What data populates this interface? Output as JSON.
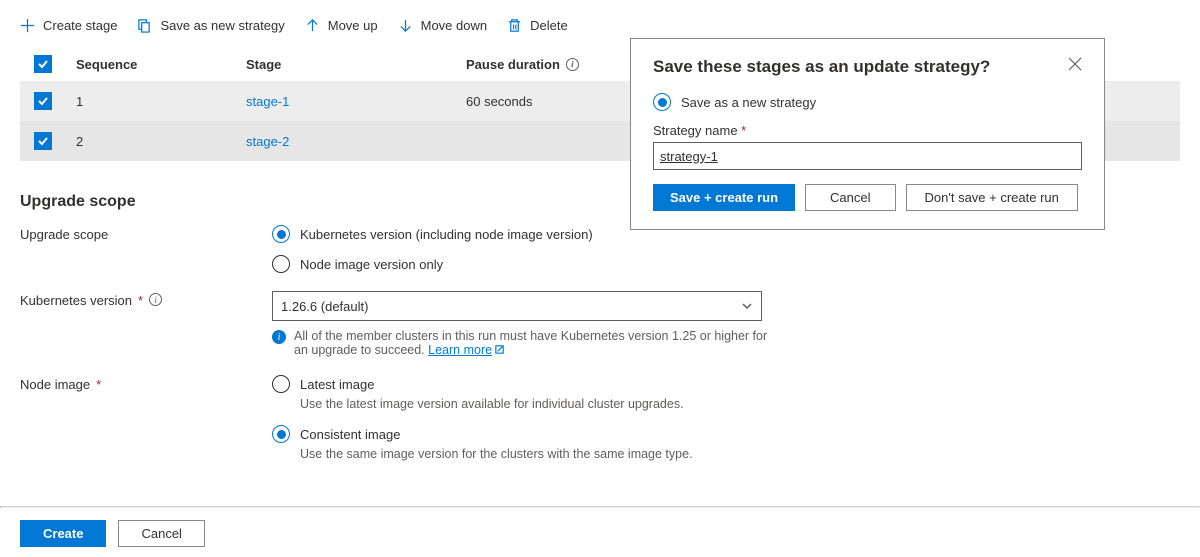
{
  "toolbar": {
    "create_stage": "Create stage",
    "save_strategy": "Save as new strategy",
    "move_up": "Move up",
    "move_down": "Move down",
    "delete": "Delete"
  },
  "table": {
    "headers": {
      "sequence": "Sequence",
      "stage": "Stage",
      "pause": "Pause duration"
    },
    "rows": [
      {
        "seq": "1",
        "stage": "stage-1",
        "pause": "60 seconds"
      },
      {
        "seq": "2",
        "stage": "stage-2",
        "pause": ""
      }
    ]
  },
  "section_upgrade": "Upgrade scope",
  "form": {
    "upgrade_scope_label": "Upgrade scope",
    "scope_opt1": "Kubernetes version (including node image version)",
    "scope_opt2": "Node image version only",
    "k8s_version_label": "Kubernetes version",
    "k8s_version_value": "1.26.6 (default)",
    "k8s_helper": "All of the member clusters in this run must have Kubernetes version 1.25 or higher for an upgrade to succeed.",
    "learn_more": "Learn more",
    "node_image_label": "Node image",
    "node_opt1": "Latest image",
    "node_opt1_sub": "Use the latest image version available for individual cluster upgrades.",
    "node_opt2": "Consistent image",
    "node_opt2_sub": "Use the same image version for the clusters with the same image type."
  },
  "footer": {
    "create": "Create",
    "cancel": "Cancel"
  },
  "dialog": {
    "title": "Save these stages as an update strategy?",
    "radio_label": "Save as a new strategy",
    "name_label": "Strategy name",
    "name_value": "strategy-1",
    "save_btn": "Save + create run",
    "cancel_btn": "Cancel",
    "dont_save_btn": "Don't save + create run"
  }
}
